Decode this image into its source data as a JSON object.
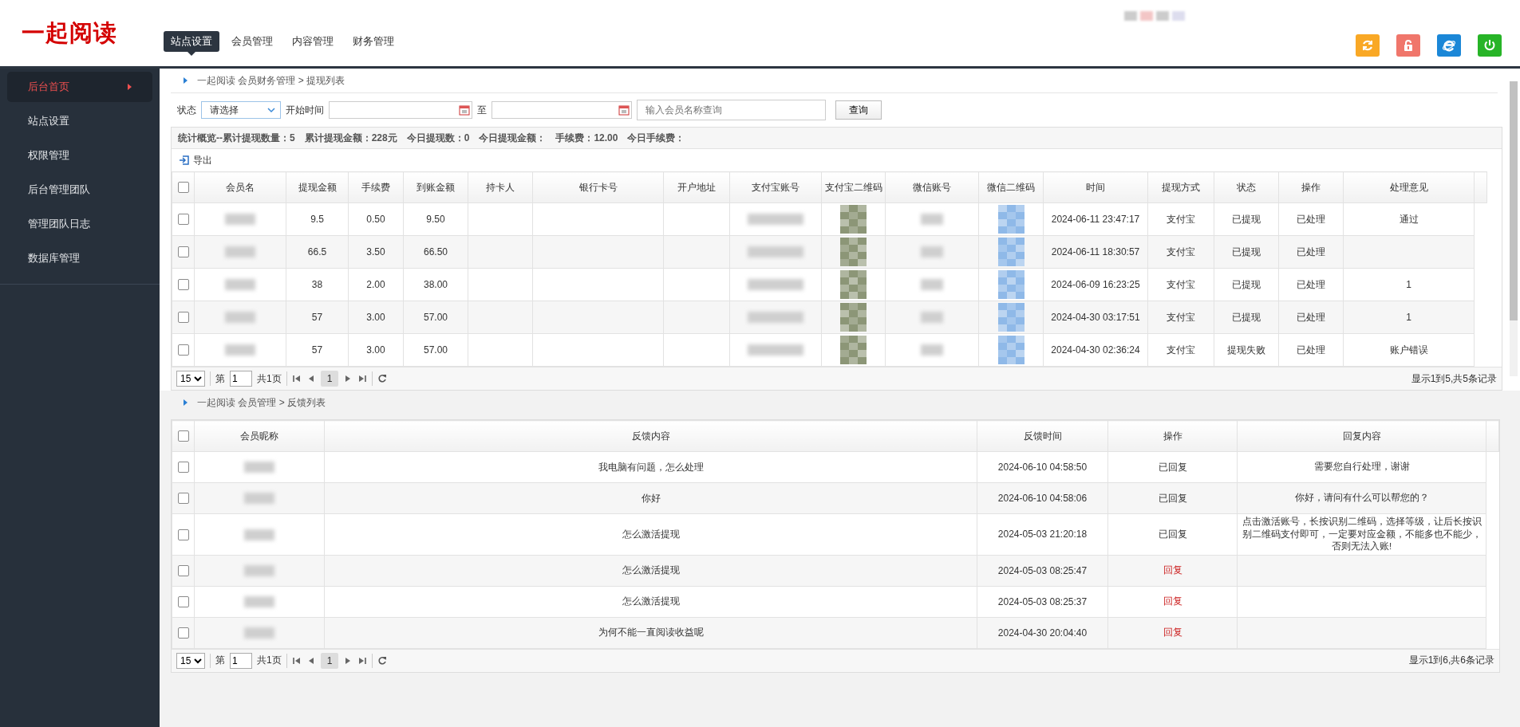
{
  "header": {
    "logo": "一起阅读",
    "nav": [
      {
        "label": "站点设置",
        "selected": true
      },
      {
        "label": "会员管理",
        "selected": false
      },
      {
        "label": "内容管理",
        "selected": false
      },
      {
        "label": "财务管理",
        "selected": false
      }
    ],
    "toolbar": [
      {
        "kind": "refresh",
        "color": "#f9a825"
      },
      {
        "kind": "lock",
        "color": "#f0766b"
      },
      {
        "kind": "browser",
        "color": "#1b87d7"
      },
      {
        "kind": "power",
        "color": "#27b427"
      }
    ]
  },
  "sidebar": {
    "items": [
      {
        "label": "后台首页",
        "selected": true
      },
      {
        "label": "站点设置",
        "selected": false
      },
      {
        "label": "权限管理",
        "selected": false
      },
      {
        "label": "后台管理团队",
        "selected": false
      },
      {
        "label": "管理团队日志",
        "selected": false
      },
      {
        "label": "数据库管理",
        "selected": false
      }
    ]
  },
  "withdrawals": {
    "breadcrumb": "一起阅读 会员财务管理 > 提现列表",
    "filter": {
      "status_label": "状态",
      "status_value": "请选择",
      "start_label": "开始时间",
      "to_label": "至",
      "search_placeholder": "输入会员名称查询",
      "search_button": "查询"
    },
    "stats": [
      "统计概览--累计提现数量：5",
      "累计提现金额：228元",
      "今日提现数：0",
      "今日提现金额：",
      "手续费：12.00",
      "今日手续费："
    ],
    "export": "导出",
    "table": {
      "select_all": {
        "checked": false
      },
      "columns": [
        {
          "label": "会员名",
          "kind": "blur"
        },
        {
          "label": "提现金额",
          "kind": "text"
        },
        {
          "label": "手续费",
          "kind": "text"
        },
        {
          "label": "到账金额",
          "kind": "text"
        },
        {
          "label": "持卡人",
          "kind": "text"
        },
        {
          "label": "银行卡号",
          "kind": "text"
        },
        {
          "label": "开户地址",
          "kind": "text"
        },
        {
          "label": "支付宝账号",
          "kind": "blur"
        },
        {
          "label": "支付宝二维码",
          "kind": "mosaic",
          "color": "#8c9677"
        },
        {
          "label": "微信账号",
          "kind": "blur"
        },
        {
          "label": "微信二维码",
          "kind": "mosaic",
          "color": "#8fb9e8"
        },
        {
          "label": "时间",
          "kind": "text"
        },
        {
          "label": "提现方式",
          "kind": "text"
        },
        {
          "label": "状态",
          "kind": "text"
        },
        {
          "label": "操作",
          "kind": "text"
        },
        {
          "label": "处理意见",
          "kind": "text"
        }
      ],
      "rows": [
        {
          "checked": false,
          "cells": [
            null,
            "9.5",
            "0.50",
            "9.50",
            null,
            null,
            null,
            null,
            null,
            null,
            null,
            "2024-06-11 23:47:17",
            "支付宝",
            "已提现",
            "已处理",
            "通过"
          ]
        },
        {
          "checked": false,
          "cells": [
            null,
            "66.5",
            "3.50",
            "66.50",
            null,
            null,
            null,
            null,
            null,
            null,
            null,
            "2024-06-11 18:30:57",
            "支付宝",
            "已提现",
            "已处理",
            null
          ]
        },
        {
          "checked": false,
          "cells": [
            null,
            "38",
            "2.00",
            "38.00",
            null,
            null,
            null,
            null,
            null,
            null,
            null,
            "2024-06-09 16:23:25",
            "支付宝",
            "已提现",
            "已处理",
            "1"
          ]
        },
        {
          "checked": false,
          "cells": [
            null,
            "57",
            "3.00",
            "57.00",
            null,
            null,
            null,
            null,
            null,
            null,
            null,
            "2024-04-30 03:17:51",
            "支付宝",
            "已提现",
            "已处理",
            "1"
          ]
        },
        {
          "checked": false,
          "cells": [
            null,
            "57",
            "3.00",
            "57.00",
            null,
            null,
            null,
            null,
            null,
            null,
            null,
            "2024-04-30 02:36:24",
            "支付宝",
            "提现失败",
            "已处理",
            "账户错误"
          ]
        }
      ]
    },
    "pager": {
      "page_size": "15",
      "page_prefix": "第",
      "page": "1",
      "page_suffix": "共1页",
      "current": "1",
      "summary": "显示1到5,共5条记录"
    }
  },
  "feedback": {
    "breadcrumb": "一起阅读 会员管理 > 反馈列表",
    "table": {
      "select_all": {
        "checked": false
      },
      "columns": [
        {
          "label": "会员昵称",
          "kind": "blur"
        },
        {
          "label": "反馈内容",
          "kind": "text"
        },
        {
          "label": "反馈时间",
          "kind": "text"
        },
        {
          "label": "操作",
          "kind": "text"
        },
        {
          "label": "回复内容",
          "kind": "text"
        }
      ],
      "rows": [
        {
          "checked": false,
          "cells": [
            null,
            "我电脑有问题，怎么处理",
            "2024-06-10 04:58:50",
            {
              "label": "已回复",
              "kind": "done"
            },
            "需要您自行处理，谢谢"
          ]
        },
        {
          "checked": false,
          "cells": [
            null,
            "你好",
            "2024-06-10 04:58:06",
            {
              "label": "已回复",
              "kind": "done"
            },
            "你好，请问有什么可以帮您的？"
          ]
        },
        {
          "checked": false,
          "cells": [
            null,
            "怎么激活提现",
            "2024-05-03 21:20:18",
            {
              "label": "已回复",
              "kind": "done"
            },
            "点击激活账号，长按识别二维码，选择等级，让后长按识别二维码支付即可，一定要对应金额，不能多也不能少，否则无法入账!"
          ]
        },
        {
          "checked": false,
          "cells": [
            null,
            "怎么激活提现",
            "2024-05-03 08:25:47",
            {
              "label": "回复",
              "kind": "link"
            },
            null
          ]
        },
        {
          "checked": false,
          "cells": [
            null,
            "怎么激活提现",
            "2024-05-03 08:25:37",
            {
              "label": "回复",
              "kind": "link"
            },
            null
          ]
        },
        {
          "checked": false,
          "cells": [
            null,
            "为何不能一直阅读收益呢",
            "2024-04-30 20:04:40",
            {
              "label": "回复",
              "kind": "link"
            },
            null
          ]
        }
      ]
    },
    "pager": {
      "page_size": "15",
      "page_prefix": "第",
      "page": "1",
      "page_suffix": "共1页",
      "current": "1",
      "summary": "显示1到6,共6条记录"
    }
  }
}
